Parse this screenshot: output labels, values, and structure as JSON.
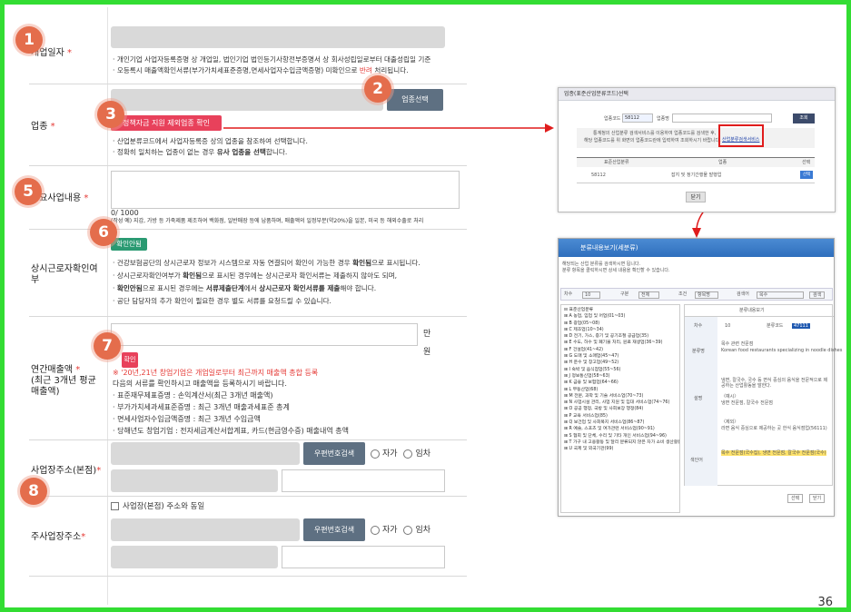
{
  "page_number": "36",
  "badges": [
    "1",
    "2",
    "3",
    "4",
    "5",
    "6",
    "7",
    "8"
  ],
  "form": {
    "open_date": {
      "label": "개업일자",
      "required": "*",
      "notes": [
        "· 개인기업 사업자등록증명 상 개업일, 법인기업 법인등기사항전부증명서 상 회사성립일로부터 대출성립일 기준",
        "· 오등록시 매출액확인서류(부가가치세표준증명,면세사업자수입금액증명) 미확인으로 ",
        "반려",
        " 처리됩니다."
      ]
    },
    "industry": {
      "label": "업종",
      "required": "*",
      "select_button": "업종선택",
      "exclusion_button": "정책자금 지원 제외업종 확인",
      "notes": [
        "· 산업분류코드에서 사업자등록증 상의 업종을 참조하여 선택합니다.",
        "· 정확히 일치하는 업종이 없는 경우 ",
        "유사 업종을 선택",
        "합니다."
      ]
    },
    "main_business": {
      "label": "주요사업내용",
      "required": "*",
      "counter": "0/ 1000",
      "example": "(작성 예) 지갑, 가방 등 가죽제품 제조하여 백화점, 일반매장 등에 납품하며, 매출액의 일정부분(약20%)을 일본, 미국 등 해외수출로 처리"
    },
    "workers": {
      "label": "상시근로자확인여부",
      "check_button": "확인안됨",
      "notes_plain": [
        "· 건강보험공단의 상시근로자 정보가 시스템으로 자동 연결되어 확인이 가능한 경우 ",
        "· 상시근로자확인여부가 ",
        "· ",
        "· 공단 담당자의 추가 확인이 필요한 경우 별도 서류를 요청드릴 수 있습니다."
      ],
      "notes_bold": [
        "확인됨",
        "확인됨",
        "확인안됨",
        "서류제출단계",
        "상시근로자 확인서류를 제출"
      ],
      "notes_tail": [
        "으로 표시됩니다.",
        "으로 표시된 경우에는 상시근로자 확인서류는 제출하지 않아도 되며,",
        "으로 표시된 경우에는 ",
        "에서 ",
        "해야 합니다."
      ]
    },
    "sales": {
      "label_line1": "연간매출액",
      "required": "*",
      "label_line2": "(최근 3개년 평균",
      "label_line3": "매출액)",
      "unit_man": "만",
      "unit_won": "원",
      "confirm_button": "확인",
      "warning": "※ '20년,21년 창업기업은 개업일로부터 최근까지 매출액 총합 등록",
      "notes": [
        "다음의 서류를 확인하시고 매출액을 등록하시기 바랍니다.",
        "· 표준재무제표증명 : 손익계산서(최근 3개년 매출액)",
        "· 부가가치세과세표준증명 : 최근 3개년 매출과세표준 총계",
        "· 면세사업자수입금액증명 : 최근 3개년 수입금액",
        "· 당해년도 창업기업 : 전자세금계산서합계표, 카드(현금영수증) 매출내역 총액"
      ]
    },
    "hq_address": {
      "label": "사업장주소(본점)",
      "required": "*",
      "zip_button": "우편번호검색",
      "own": "자가",
      "rent": "임차"
    },
    "main_address": {
      "label": "주사업장주소",
      "required": "*",
      "same_checkbox": "사업장(본점) 주소와 동일",
      "zip_button": "우편번호검색",
      "own": "자가",
      "rent": "임차"
    }
  },
  "popup_industry": {
    "title": "업종(표준산업분류코드)선택",
    "code_label": "업종코드",
    "code_value": "58112",
    "name_label": "업종명",
    "search_button": "조회",
    "desc1": "통계청의 산업분류 검색서비스를 이용하여 업종코드를 검색한 후,",
    "desc2": "해당 업종코드를 위 화면의 업종코드란에 입력하여 조회하시기 바랍니다.",
    "link": "산업분류검색서비스",
    "col_code": "표준산업분류",
    "col_name": "업종",
    "col_select": "선택",
    "row_code": "58112",
    "row_name": "잡지 및 정기간행물 발행업",
    "row_select": "선택",
    "close_button": "닫기"
  },
  "popup_search": {
    "title": "분류내용보기(세분류)",
    "intro1": "해당되는 산업 분류를 검색하시면 됩니다.",
    "intro2": "분류 항목을 클릭하시면 상세 내용을 확인할 수 있습니다.",
    "intro3": "",
    "filter_count_label": "차수",
    "filter_count_value": "10",
    "filter_type_label": "구분",
    "filter_type_value": "전체",
    "filter_cond_label": "조건",
    "filter_cond_value": "항목명",
    "search_label": "검색어",
    "search_value": "목수",
    "search_button": "검색",
    "tree": [
      "표준산업분류",
      "A 농업, 임업 및 어업(01~03)",
      "B 광업(05~08)",
      "C 제조업(10~34)",
      "D 전기, 가스, 증기 및 공기조절 공급업(35)",
      "E 수도, 하수 및 폐기물 처리, 원료 재생업(36~39)",
      "F 건설업(41~42)",
      "G 도매 및 소매업(45~47)",
      "H 운수 및 창고업(49~52)",
      "I 숙박 및 음식점업(55~56)",
      "J 정보통신업(58~63)",
      "K 금융 및 보험업(64~66)",
      "L 부동산업(68)",
      "M 전문, 과학 및 기술 서비스업(70~73)",
      "N 사업시설 관리, 사업 지원 및 임대 서비스업(74~76)",
      "O 공공 행정, 국방 및 사회보장 행정(84)",
      "P 교육 서비스업(85)",
      "Q 보건업 및 사회복지 서비스업(86~87)",
      "R 예술, 스포츠 및 여가관련 서비스업(90~91)",
      "S 협회 및 단체, 수리 및 기타 개인 서비스업(94~96)",
      "T 가구 내 고용활동 및 달리 분류되지 않은 자가 소비 생산활동(97~98)",
      "U 국제 및 외국기관(99)"
    ],
    "detail_title": "분류내용보기",
    "code_label": "차수",
    "code_value": "10",
    "class_label": "분류코드",
    "class_value": "47111",
    "name_label": "분류명",
    "name_value": "목수 관련 전문점",
    "name_en": "Korean food restaurants specializing in noodle dishes",
    "desc_label": "설명",
    "desc1": "냉면, 칼국수, 국수 등 면식 중심의 음식을 전문적으로 제공하는 산업활동을 말한다.",
    "desc_ex1": "〈예시〉",
    "desc_ex2": "냉면 전문점, 칼국수 전문점",
    "desc_ex3": "〈제외〉",
    "desc_ex4": "라면 음식 중심으로 제공하는 곳 한식 음식점업(56111)",
    "example_label": "색인어",
    "example_value": "목수 전문점(국수집), 냉면 전문점, 칼국수 전문점(국수)",
    "btn_ok": "선택",
    "btn_close": "닫기"
  }
}
